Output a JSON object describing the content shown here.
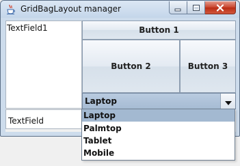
{
  "window": {
    "title": "GridBagLayout manager"
  },
  "fields": {
    "textfield1": "TextField1",
    "textfield2": "TextField"
  },
  "buttons": {
    "button1": "Button 1",
    "button2": "Button 2",
    "button3": "Button 3"
  },
  "combo": {
    "selected": "Laptop",
    "options": [
      "Laptop",
      "Palmtop",
      "Tablet",
      "Mobile"
    ],
    "highlighted_index": 0
  },
  "icons": {
    "app": "java-cup-icon",
    "minimize": "minimize-icon",
    "maximize": "maximize-icon",
    "close": "close-icon",
    "dropdown": "chevron-down-icon"
  },
  "colors": {
    "titlebar": "#c4d6ea",
    "close_button": "#c8432c",
    "selection": "#a3b9d1"
  }
}
